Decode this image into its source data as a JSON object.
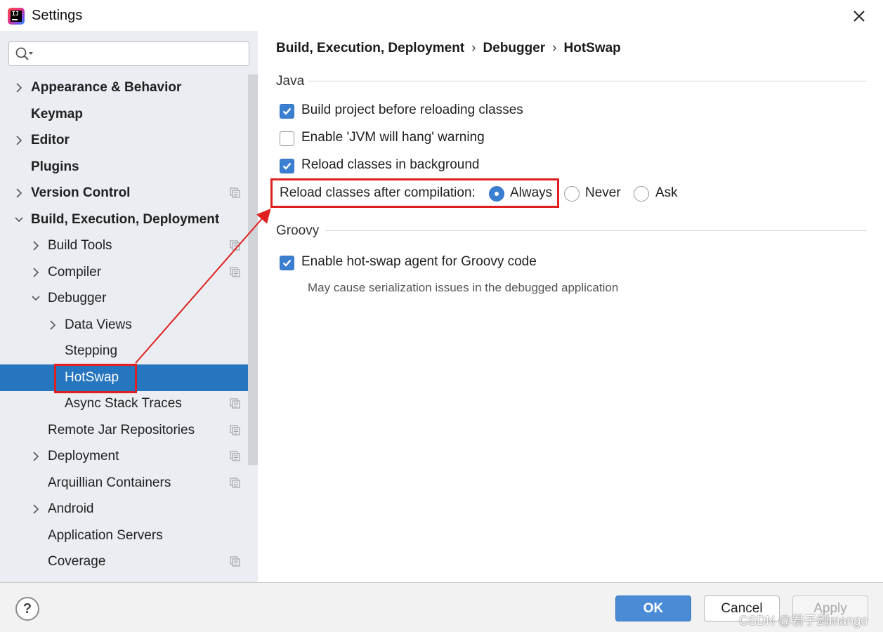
{
  "window": {
    "title": "Settings"
  },
  "search": {
    "placeholder": ""
  },
  "sidebar": {
    "items": [
      {
        "label": "Appearance & Behavior",
        "depth": 0,
        "bold": true,
        "chevron": "right",
        "project_icon": false,
        "selected": false
      },
      {
        "label": "Keymap",
        "depth": 0,
        "bold": true,
        "chevron": "none",
        "project_icon": false,
        "selected": false
      },
      {
        "label": "Editor",
        "depth": 0,
        "bold": true,
        "chevron": "right",
        "project_icon": false,
        "selected": false
      },
      {
        "label": "Plugins",
        "depth": 0,
        "bold": true,
        "chevron": "none",
        "project_icon": false,
        "selected": false
      },
      {
        "label": "Version Control",
        "depth": 0,
        "bold": true,
        "chevron": "right",
        "project_icon": true,
        "selected": false
      },
      {
        "label": "Build, Execution, Deployment",
        "depth": 0,
        "bold": true,
        "chevron": "down",
        "project_icon": false,
        "selected": false
      },
      {
        "label": "Build Tools",
        "depth": 1,
        "bold": false,
        "chevron": "right",
        "project_icon": true,
        "selected": false
      },
      {
        "label": "Compiler",
        "depth": 1,
        "bold": false,
        "chevron": "right",
        "project_icon": true,
        "selected": false
      },
      {
        "label": "Debugger",
        "depth": 1,
        "bold": false,
        "chevron": "down",
        "project_icon": false,
        "selected": false
      },
      {
        "label": "Data Views",
        "depth": 2,
        "bold": false,
        "chevron": "right",
        "project_icon": false,
        "selected": false
      },
      {
        "label": "Stepping",
        "depth": 2,
        "bold": false,
        "chevron": "none",
        "project_icon": false,
        "selected": false
      },
      {
        "label": "HotSwap",
        "depth": 2,
        "bold": false,
        "chevron": "none",
        "project_icon": false,
        "selected": true
      },
      {
        "label": "Async Stack Traces",
        "depth": 2,
        "bold": false,
        "chevron": "none",
        "project_icon": true,
        "selected": false
      },
      {
        "label": "Remote Jar Repositories",
        "depth": 1,
        "bold": false,
        "chevron": "none",
        "project_icon": true,
        "selected": false
      },
      {
        "label": "Deployment",
        "depth": 1,
        "bold": false,
        "chevron": "right",
        "project_icon": true,
        "selected": false
      },
      {
        "label": "Arquillian Containers",
        "depth": 1,
        "bold": false,
        "chevron": "none",
        "project_icon": true,
        "selected": false
      },
      {
        "label": "Android",
        "depth": 1,
        "bold": false,
        "chevron": "right",
        "project_icon": false,
        "selected": false
      },
      {
        "label": "Application Servers",
        "depth": 1,
        "bold": false,
        "chevron": "none",
        "project_icon": false,
        "selected": false
      },
      {
        "label": "Coverage",
        "depth": 1,
        "bold": false,
        "chevron": "none",
        "project_icon": true,
        "selected": false
      }
    ]
  },
  "breadcrumb": {
    "part1": "Build, Execution, Deployment",
    "part2": "Debugger",
    "part3": "HotSwap",
    "separator": "›"
  },
  "java": {
    "title": "Java",
    "build_before_reload": {
      "label": "Build project before reloading classes",
      "checked": true
    },
    "jvm_hang_warning": {
      "label": "Enable 'JVM will hang' warning",
      "checked": false
    },
    "reload_in_background": {
      "label": "Reload classes in background",
      "checked": true
    },
    "reload_after_compilation": {
      "label": "Reload classes after compilation:",
      "options": [
        "Always",
        "Never",
        "Ask"
      ],
      "selected": "Always"
    }
  },
  "groovy": {
    "title": "Groovy",
    "hotswap_agent": {
      "label": "Enable hot-swap agent for Groovy code",
      "checked": true
    },
    "hint": "May cause serialization issues in the debugged application"
  },
  "footer": {
    "help_label": "?",
    "ok_label": "OK",
    "cancel_label": "Cancel",
    "apply_label": "Apply",
    "watermark": "CSDN @君子剑mango"
  },
  "colors": {
    "accent": "#3b7fd1",
    "selection": "#2675bf",
    "annotation": "#e02020"
  }
}
